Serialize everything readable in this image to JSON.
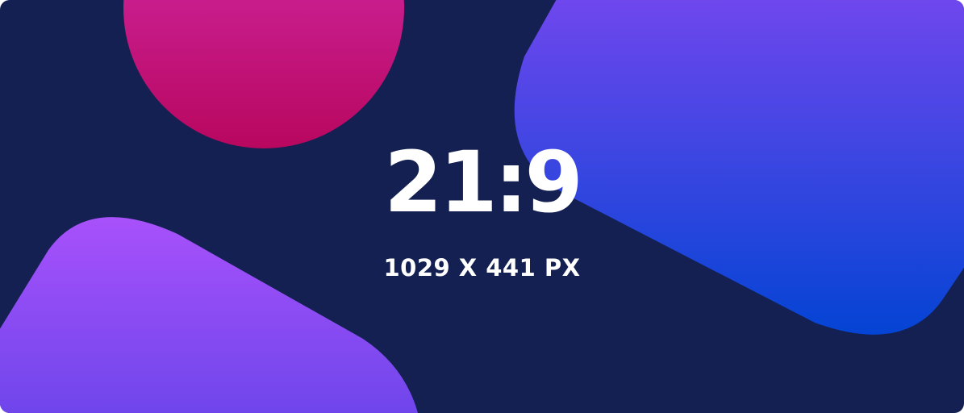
{
  "banner": {
    "ratio_label": "21:9",
    "dimensions_label": "1029 X 441 PX"
  },
  "colors": {
    "background": "#132051",
    "circle_top": "#d630b4",
    "circle_bottom": "#b8075f",
    "right_blob_top": "#7147ee",
    "right_blob_bottom": "#0444d4",
    "left_blob_top": "#a851fb",
    "left_blob_bottom": "#6b45ea",
    "text": "#ffffff"
  }
}
